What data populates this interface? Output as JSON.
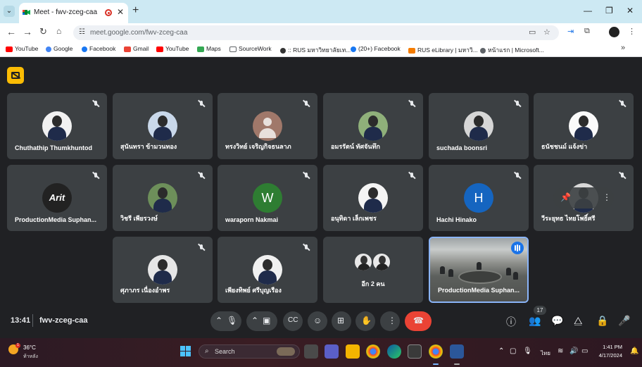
{
  "browser": {
    "tab_title": "Meet - fwv-zceg-caa",
    "new_tab_symbol": "+",
    "url": "meet.google.com/fwv-zceg-caa",
    "bookmarks": [
      {
        "label": "YouTube",
        "icon": "youtube-icon",
        "color": "#ff0000"
      },
      {
        "label": "Google",
        "icon": "google-icon",
        "color": "#4285f4"
      },
      {
        "label": "Facebook",
        "icon": "facebook-icon",
        "color": "#1877f2"
      },
      {
        "label": "Gmail",
        "icon": "gmail-icon",
        "color": "#ea4335"
      },
      {
        "label": "YouTube",
        "icon": "youtube-icon",
        "color": "#ff0000"
      },
      {
        "label": "Maps",
        "icon": "maps-icon",
        "color": "#34a853"
      },
      {
        "label": "SourceWork",
        "icon": "folder-icon",
        "color": "#5f6368"
      },
      {
        "label": ":: RUS มหาวิทยาลัยเท...",
        "icon": "web-icon",
        "color": "#333333"
      },
      {
        "label": "(20+) Facebook",
        "icon": "facebook-icon",
        "color": "#1877f2"
      },
      {
        "label": "RUS eLibrary | มหาวิ...",
        "icon": "library-icon",
        "color": "#f57c00"
      },
      {
        "label": "หน้าแรก | Microsoft...",
        "icon": "web-icon",
        "color": "#5f6368"
      }
    ]
  },
  "meet": {
    "participants": [
      {
        "name": "Chuthathip Thumkhuntod",
        "avatar": "photo",
        "muted": true
      },
      {
        "name": "สุนันทรา ข้ามวนทอง",
        "avatar": "photo",
        "muted": true
      },
      {
        "name": "ทรงวิทย์ เจริญกิจธนลาภ",
        "avatar": "generic",
        "muted": true
      },
      {
        "name": "อมรรัตน์ ทัศจันทึก",
        "avatar": "photo",
        "muted": true
      },
      {
        "name": "suchada boonsri",
        "avatar": "photo",
        "muted": true
      },
      {
        "name": "ธนัชชนม์ แจ้งข่า",
        "avatar": "photo",
        "muted": true
      },
      {
        "name": "ProductionMedia Suphan...",
        "avatar": "logo",
        "avatar_text": "Arit",
        "muted": true
      },
      {
        "name": "วิชรี เพียรวงษ์",
        "avatar": "photo",
        "muted": true
      },
      {
        "name": "waraporn Nakmai",
        "avatar": "letter",
        "letter": "W",
        "letter_color": "#2e7d32",
        "muted": true
      },
      {
        "name": "อนุทิดา เล็กเพชร",
        "avatar": "photo",
        "muted": true
      },
      {
        "name": "Hachi Hinako",
        "avatar": "letter",
        "letter": "H",
        "letter_color": "#1565c0",
        "muted": true
      },
      {
        "name": "วีระยุทธ ไทยโพธิ์ศรี",
        "avatar": "photo",
        "muted": true
      },
      {
        "name": "ศุภาภร เนื่องอำพร",
        "avatar": "photo",
        "muted": true
      },
      {
        "name": "เพียงทิพย์ ศรีบุญเรือง",
        "avatar": "photo",
        "muted": true
      },
      {
        "name": "อีก 2 คน",
        "avatar": "group"
      },
      {
        "name": "ProductionMedia Suphan...",
        "avatar": "video",
        "speaking": true
      }
    ],
    "clock": "13:41",
    "separator": "|",
    "meeting_code": "fwv-zceg-caa",
    "people_count": "17",
    "colors": {
      "end_call": "#ea4335",
      "info_button": "#fbbc04",
      "active_border": "#8ab4f8"
    }
  },
  "taskbar": {
    "temperature": "36°C",
    "weather_desc": "ท้าหลัง",
    "search_placeholder": "Search",
    "tray_lang": "ไทย",
    "time": "1:41 PM",
    "date": "4/17/2024",
    "apps": [
      "file-explorer-icon",
      "teams-icon",
      "folder-icon",
      "chrome-icon",
      "edge-icon",
      "store-icon",
      "chrome-profile-icon",
      "word-icon"
    ]
  }
}
